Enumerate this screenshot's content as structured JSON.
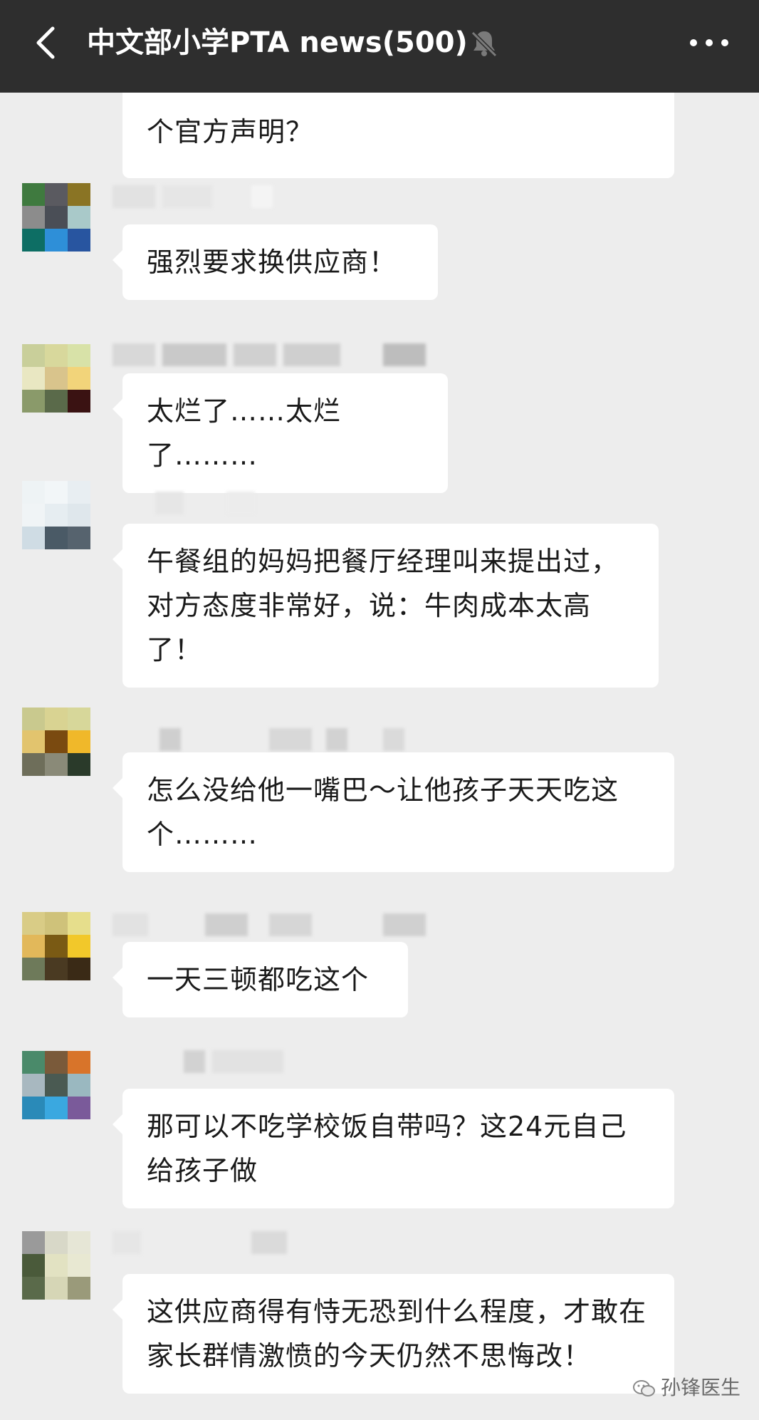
{
  "header": {
    "title": "中文部小学PTA news(500)",
    "back_icon": "chevron-left-icon",
    "mute_icon": "bell-off-icon",
    "more_icon": "more-dots-icon"
  },
  "messages": [
    {
      "text": "个官方声明？"
    },
    {
      "text": "强烈要求换供应商！"
    },
    {
      "text": "太烂了……太烂了………"
    },
    {
      "text": "午餐组的妈妈把餐厅经理叫来提出过，对方态度非常好，说：牛肉成本太高了！"
    },
    {
      "text": "怎么没给他一嘴巴～让他孩子天天吃这个………"
    },
    {
      "text": "一天三顿都吃这个"
    },
    {
      "text": "那可以不吃学校饭自带吗？这24元自己给孩子做"
    },
    {
      "text": "这供应商得有恃无恐到什么程度，才敢在家长群情激愤的今天仍然不思悔改！"
    }
  ],
  "watermark": {
    "text": "孙锋医生",
    "icon": "wechat-icon"
  },
  "colors": {
    "topbar": "#2e2e2e",
    "background": "#ededed",
    "bubble": "#ffffff"
  }
}
